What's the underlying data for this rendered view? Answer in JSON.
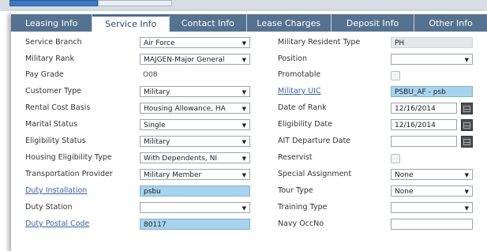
{
  "tabs": [
    {
      "label": "Leasing Info",
      "active": false
    },
    {
      "label": "Service Info",
      "active": true
    },
    {
      "label": "Contact Info",
      "active": false
    },
    {
      "label": "Lease Charges",
      "active": false
    },
    {
      "label": "Deposit Info",
      "active": false
    },
    {
      "label": "Other Info",
      "active": false
    }
  ],
  "left": {
    "service_branch": {
      "label": "Service Branch",
      "value": "Air Force"
    },
    "military_rank": {
      "label": "Military Rank",
      "value": "MAJGEN-Major General"
    },
    "pay_grade": {
      "label": "Pay Grade",
      "value": "O08"
    },
    "customer_type": {
      "label": "Customer Type",
      "value": "Military"
    },
    "rental_cost_basis": {
      "label": "Rental Cost Basis",
      "value": "Housing Allowance, HA"
    },
    "marital_status": {
      "label": "Marital Status",
      "value": "Single"
    },
    "eligibility_status": {
      "label": "Eligibility Status",
      "value": "Military"
    },
    "housing_eligibility_type": {
      "label": "Housing Eligibility Type",
      "value": "With Dependents, NI"
    },
    "transportation_provider": {
      "label": "Transportation Provider",
      "value": "Military Member"
    },
    "duty_installation": {
      "label": "Duty Installation",
      "value": "psbu"
    },
    "duty_station": {
      "label": "Duty Station",
      "value": ""
    },
    "duty_postal_code": {
      "label": "Duty Postal Code",
      "value": "80117"
    }
  },
  "right": {
    "military_resident_type": {
      "label": "Military Resident Type",
      "value": "PH"
    },
    "position": {
      "label": "Position",
      "value": ""
    },
    "promotable": {
      "label": "Promotable"
    },
    "military_uic": {
      "label": "Military UIC",
      "value": "PSBU_AF - psb"
    },
    "date_of_rank": {
      "label": "Date of Rank",
      "value": "12/16/2014"
    },
    "eligibility_date": {
      "label": "Eligibility Date",
      "value": "12/16/2014"
    },
    "ait_departure_date": {
      "label": "AIT Departure Date",
      "value": ""
    },
    "reservist": {
      "label": "Reservist"
    },
    "special_assignment": {
      "label": "Special Assignment",
      "value": "None"
    },
    "tour_type": {
      "label": "Tour Type",
      "value": "None"
    },
    "training_type": {
      "label": "Training Type",
      "value": ""
    },
    "navy_occno": {
      "label": "Navy OccNo",
      "value": ""
    }
  },
  "icons": {
    "dropdown": "chevron-down-icon",
    "calendar": "calendar-icon"
  }
}
